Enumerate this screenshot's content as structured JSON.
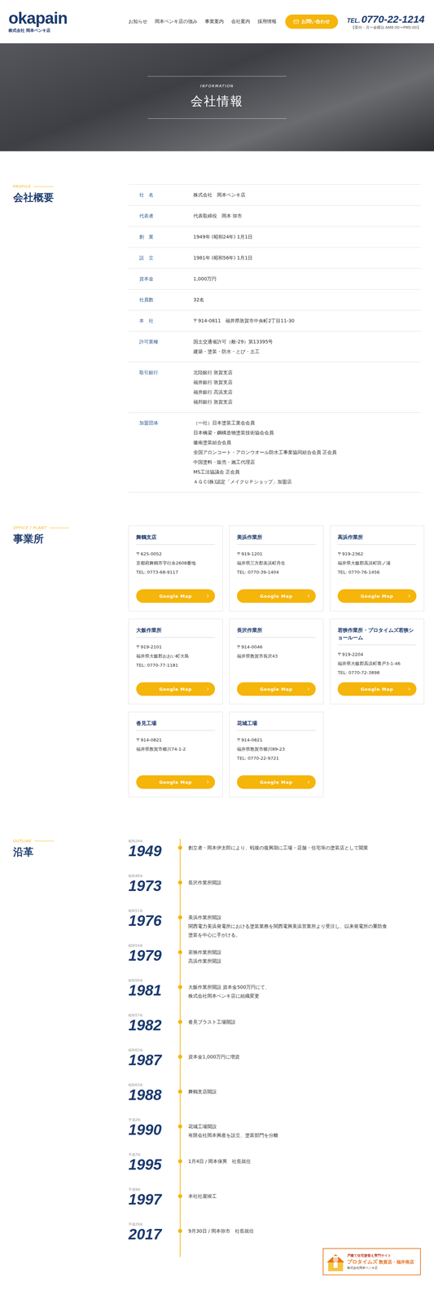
{
  "header": {
    "logo": "okapain",
    "logo_sub": "株式会社 岡本ペンキ店",
    "nav": [
      "お知らせ",
      "岡本ペンキ店の強み",
      "事業案内",
      "会社案内",
      "採用情報"
    ],
    "contact_button": "お問い合わせ",
    "tel_label": "TEL.",
    "tel": "0770-22-1214",
    "hours": "【受付：月〜金曜日 AM8:00〜PM5:00】"
  },
  "hero": {
    "subtitle": "INFORMATION",
    "title": "会社情報"
  },
  "profile": {
    "label": "PROFILE",
    "title": "会社概要",
    "rows": [
      {
        "label": "社　名",
        "lines": [
          "株式会社　岡本ペンキ店"
        ]
      },
      {
        "label": "代表者",
        "lines": [
          "代表取締役　岡本 弥市"
        ]
      },
      {
        "label": "創　業",
        "lines": [
          "1949年 (昭和24年) 1月1日"
        ]
      },
      {
        "label": "設　立",
        "lines": [
          "1981年 (昭和56年) 1月1日"
        ]
      },
      {
        "label": "資本金",
        "lines": [
          "1,000万円"
        ]
      },
      {
        "label": "社員数",
        "lines": [
          "32名"
        ]
      },
      {
        "label": "本　社",
        "lines": [
          "〒914-0811　福井県敦賀市中央町2丁目11-30"
        ]
      },
      {
        "label": "許可業種",
        "lines": [
          "国土交通省許可（般-29）第13395号",
          "建築・塗装・防水・とび・土工"
        ]
      },
      {
        "label": "取引銀行",
        "lines": [
          "北陸銀行 敦賀支店",
          "福井銀行 敦賀支店",
          "福井銀行 高浜支店",
          "福邦銀行 敦賀支店"
        ]
      },
      {
        "label": "加盟団体",
        "lines": [
          "（一社）日本塗装工業会会員",
          "日本橋梁・鋼構造物塗装技術協会会員",
          "徽南塗装組合会員",
          "全国アロンコート・アロンウオール防水工事業協同組合会員 正会員",
          "中国塗料・販売・施工代理店",
          "MS工法協議会 正会員",
          "ＡＧＣ(株)認定「メイクＵＰショップ」加盟店"
        ]
      }
    ]
  },
  "offices": {
    "label": "OFFICE / PLANT",
    "title": "事業所",
    "button": "Google Map",
    "items": [
      {
        "name": "舞鶴支店",
        "lines": [
          "〒625-0052",
          "京都府舞鶴市字行永2608番地",
          "TEL: 0773-68-9117"
        ]
      },
      {
        "name": "美浜作業所",
        "lines": [
          "〒919-1201",
          "福井県三方郡美浜町丹生",
          "TEL: 0770-39-1404"
        ]
      },
      {
        "name": "高浜作業所",
        "lines": [
          "〒919-2362",
          "福井県大飯郡高浜町田ノ浦",
          "TEL: 0770-76-1456"
        ]
      },
      {
        "name": "大飯作業所",
        "lines": [
          "〒919-2101",
          "福井県大飯郡おおい町大島",
          "TEL: 0770-77-1181"
        ]
      },
      {
        "name": "長沢作業所",
        "lines": [
          "〒914-0046",
          "福井県敦賀市長沢43"
        ]
      },
      {
        "name": "若狭作業所・プロタイムズ若狭ショールーム",
        "lines": [
          "〒919-2204",
          "福井県大飯郡高浜町青戸3-1-46",
          "TEL: 0770-72-3898"
        ]
      },
      {
        "name": "沓見工場",
        "lines": [
          "〒914-0821",
          "福井県敦賀市櫛川74-1-2"
        ]
      },
      {
        "name": "花城工場",
        "lines": [
          "〒914-0821",
          "福井県敦賀市櫛川89-23",
          "TEL: 0770-22-9721"
        ]
      }
    ]
  },
  "outline": {
    "label": "OUTLINE",
    "title": "沿革",
    "items": [
      {
        "era": "昭和24年",
        "year": "1949",
        "lines": [
          "創立者・岡本伊太郎により、戦後の復興期に工場・店舗・住宅等の塗装店として開業"
        ]
      },
      {
        "era": "昭和48年",
        "year": "1973",
        "lines": [
          "長沢作業所開設"
        ]
      },
      {
        "era": "昭和51年",
        "year": "1976",
        "lines": [
          "美浜作業所開設",
          "関西電力美浜発電所における塗装業務を関西電興美浜営業所より受注し、以来発電所の重防食塗装を中心に手がける。"
        ]
      },
      {
        "era": "昭和54年",
        "year": "1979",
        "lines": [
          "若狭作業所開設",
          "高浜作業所開設"
        ]
      },
      {
        "era": "昭和56年",
        "year": "1981",
        "lines": [
          "大飯作業所開設 資本金500万円にて、",
          "株式会社岡本ペンキ店に組織変更"
        ]
      },
      {
        "era": "昭和57年",
        "year": "1982",
        "lines": [
          "沓見ブラスト工場開設"
        ]
      },
      {
        "era": "昭和62年",
        "year": "1987",
        "lines": [
          "資本金1,000万円に増資"
        ]
      },
      {
        "era": "昭和63年",
        "year": "1988",
        "lines": [
          "舞鶴支店開設"
        ]
      },
      {
        "era": "平成2年",
        "year": "1990",
        "lines": [
          "花城工場開設",
          "有限会社岡本興産を設立、塗装部門を分離"
        ]
      },
      {
        "era": "平成7年",
        "year": "1995",
        "lines": [
          "1月4日 / 岡本保男　社長就任"
        ]
      },
      {
        "era": "平成9年",
        "year": "1997",
        "lines": [
          "本社社屋竣工"
        ]
      },
      {
        "era": "平成29年",
        "year": "2017",
        "lines": [
          "9月30日 / 岡本弥市　社長就任"
        ]
      }
    ]
  },
  "banner": {
    "caption": "戸建て住宅塗替え専門サイト",
    "brand": "プロタイムズ",
    "stores": "敦賀店・福井南店",
    "company": "株式会社岡本ペンキ店"
  }
}
